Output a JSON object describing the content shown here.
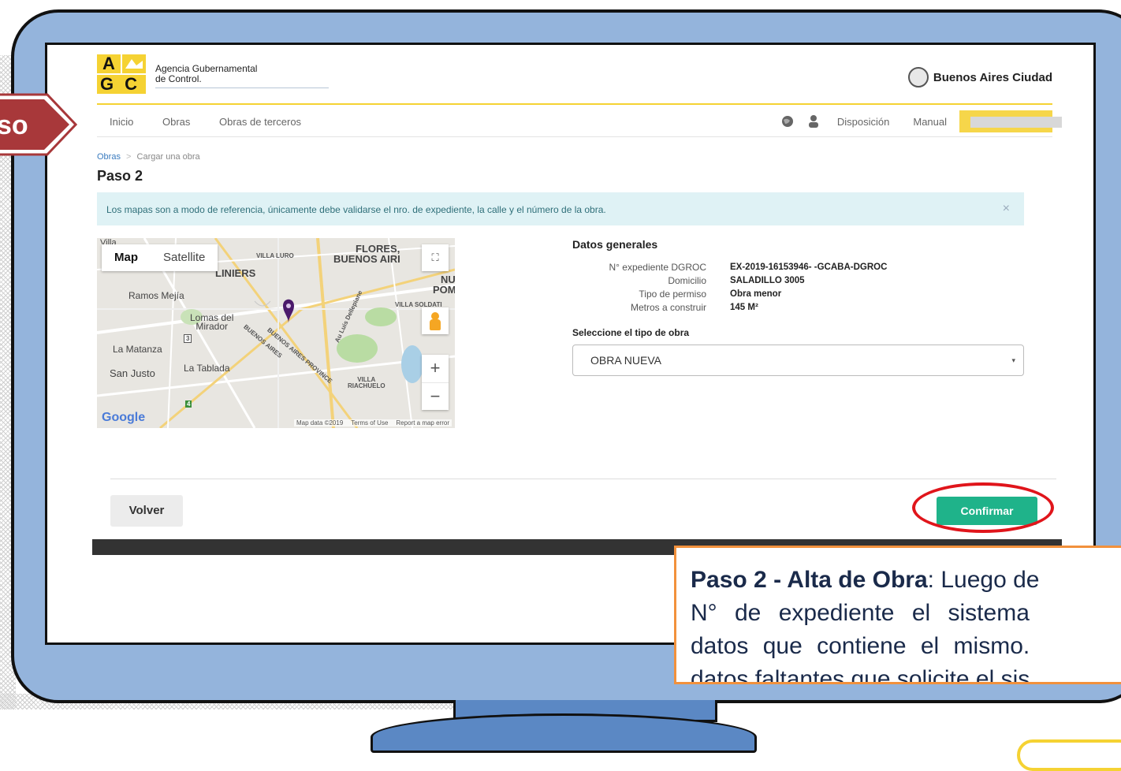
{
  "header": {
    "agency_line1": "Agencia Gubernamental",
    "agency_line2": "de Control.",
    "logo_letters": [
      "A",
      "GC"
    ],
    "brand": "Buenos Aires Ciudad"
  },
  "step_tag": "so",
  "nav": {
    "items": [
      "Inicio",
      "Obras",
      "Obras de terceros"
    ],
    "right": [
      "Disposición",
      "Manual"
    ]
  },
  "breadcrumb": {
    "root": "Obras",
    "sep": ">",
    "current": "Cargar una obra"
  },
  "title": "Paso 2",
  "alert": {
    "text": "Los mapas son a modo de referencia, únicamente debe validarse el nro. de expediente, la calle y el número de la obra.",
    "close": "×"
  },
  "map": {
    "tabs": [
      "Map",
      "Satellite"
    ],
    "fullscreen": "⛶",
    "zoom_in": "+",
    "zoom_out": "−",
    "labels": {
      "villa": "Villa",
      "flores": "FLORES,",
      "buenos_aires": "BUENOS AIRI",
      "liniers": "LINIERS",
      "villa_luro": "VILLA LURO",
      "ramos": "Ramos Mejía",
      "lomas1": "Lomas del",
      "lomas2": "Mirador",
      "matanza": "La Matanza",
      "justo": "San Justo",
      "tablada": "La Tablada",
      "soldati": "VILLA SOLDATI",
      "riachuelo1": "VILLA",
      "riachuelo2": "RIACHUELO",
      "dellepiane": "Au Luis Dellepiane",
      "prov1": "BUENOS AIRES",
      "prov2": "BUENOS AIRES PROVINCE",
      "nu": "NU",
      "pom": "POM",
      "route3": "3",
      "route4": "4"
    },
    "google": "Google",
    "attribution": [
      "Map data ©2019",
      "Terms of Use",
      "Report a map error"
    ]
  },
  "datos": {
    "heading": "Datos generales",
    "rows": [
      {
        "k": "N° expediente DGROC",
        "v": "EX-2019-16153946- -GCABA-DGROC"
      },
      {
        "k": "Domicilio",
        "v": "SALADILLO 3005"
      },
      {
        "k": "Tipo de permiso",
        "v": "Obra menor"
      },
      {
        "k": "Metros a construir",
        "v": "145 M²"
      }
    ]
  },
  "select": {
    "label": "Seleccione el tipo de obra",
    "value": "OBRA NUEVA",
    "caret": "▾"
  },
  "buttons": {
    "back": "Volver",
    "confirm": "Confirmar"
  },
  "callout": {
    "l1_b1": "Paso 2",
    "l1_dash": " - ",
    "l1_b2": "Alta de Obra",
    "l1_rest": ": Luego de",
    "l2": "N° de expediente el sistema",
    "l3": "datos que contiene el mismo.",
    "l4": "datos faltantes que solicite el sis"
  },
  "colors": {
    "accent_yellow": "#f5d233",
    "confirm_green": "#1fb38a",
    "frame_blue": "#94b4dc",
    "callout_border": "#f2913c",
    "highlight_red": "#e0151b"
  }
}
